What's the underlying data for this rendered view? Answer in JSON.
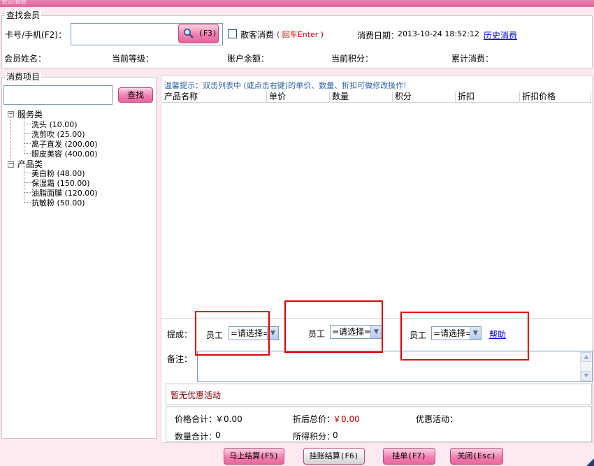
{
  "window": {
    "title": "会员消费"
  },
  "search": {
    "legend": "查找会员",
    "card_label": "卡号/手机(F2)：",
    "card_value": "",
    "search_button": "(F3)",
    "walkin_label": "散客消费",
    "walkin_hint": "( 回车Enter )",
    "date_label": "消费日期：",
    "date_value": "2013-10-24 18:52:12",
    "history_link": "历史消费"
  },
  "member": {
    "name_label": "会员姓名：",
    "level_label": "当前等级：",
    "balance_label": "账户余额：",
    "points_label": "当前积分：",
    "total_label": "累计消费："
  },
  "items_panel": {
    "legend": "消费项目",
    "search_value": "",
    "find_button": "查找",
    "categories": [
      {
        "name": "服务类",
        "expander": "−",
        "items": [
          "洗头 (10.00)",
          "洗剪吹 (25.00)",
          "离子直发 (200.00)",
          "眼皮美容 (400.00)"
        ]
      },
      {
        "name": "产品类",
        "expander": "−",
        "items": [
          "美白粉 (48.00)",
          "保湿霜 (150.00)",
          "油脂面膜 (120.00)",
          "抗敏粉 (50.00)"
        ]
      }
    ]
  },
  "tip": "温馨提示：双击列表中 (或点击右键)的单价、数量、折扣可做修改操作!",
  "table": {
    "headers": [
      "产品名称",
      "单价",
      "数量",
      "积分",
      "折扣",
      "折扣价格"
    ]
  },
  "commission": {
    "label": "提成：",
    "employees": [
      {
        "label": "员工",
        "value": "=请选择="
      },
      {
        "label": "员工",
        "value": "=请选择="
      },
      {
        "label": "员工",
        "value": "=请选择="
      }
    ],
    "help_link": "帮助"
  },
  "remarks": {
    "label": "备注：",
    "value": ""
  },
  "promo": {
    "text": "暂无优惠活动"
  },
  "summary": {
    "price_total_label": "价格合计：",
    "price_total_value": "￥0.00",
    "discount_total_label": "折后总价：",
    "discount_total_value": "￥0.00",
    "promotion_label": "优惠活动：",
    "qty_total_label": "数量合计：",
    "qty_total_value": "0",
    "points_earned_label": "所得积分：",
    "points_earned_value": "0"
  },
  "footer_buttons": {
    "checkout": "马上结算(F5)",
    "credit_checkout": "挂账结算(F6)",
    "hang_order": "挂单(F7)",
    "close": "关闭(Esc)"
  },
  "colors": {
    "accent_pink": "#ef7fb1",
    "price_red": "#b00000",
    "promo_text": "#800000",
    "tip_blue": "#2f63a8",
    "highlight_box": "#e00000"
  }
}
